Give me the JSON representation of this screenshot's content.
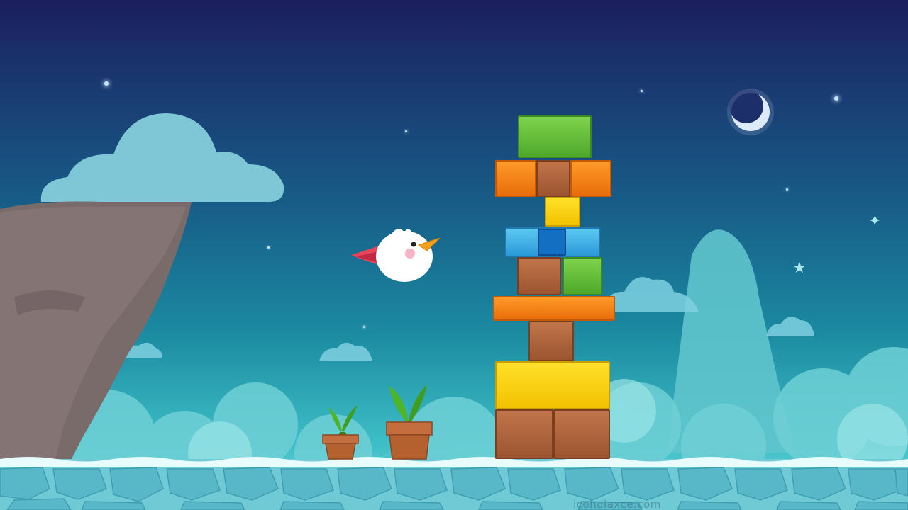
{
  "scene": {
    "title": "",
    "watermark": "icohdlaxce.com"
  },
  "colors": {
    "sky_top": "#1b1e5e",
    "sky_bottom": "#8fe0e0",
    "ice": "#7fd6e0",
    "cliff": "#7a6b6b",
    "bird": "#ffffff",
    "bird_wing": "#e8445a"
  },
  "tower": {
    "block_colors": [
      "green",
      "orange",
      "brown",
      "orange",
      "yellow",
      "blue",
      "blue-dark",
      "brown",
      "green",
      "orange",
      "brown",
      "yellow",
      "brown",
      "brown"
    ]
  }
}
